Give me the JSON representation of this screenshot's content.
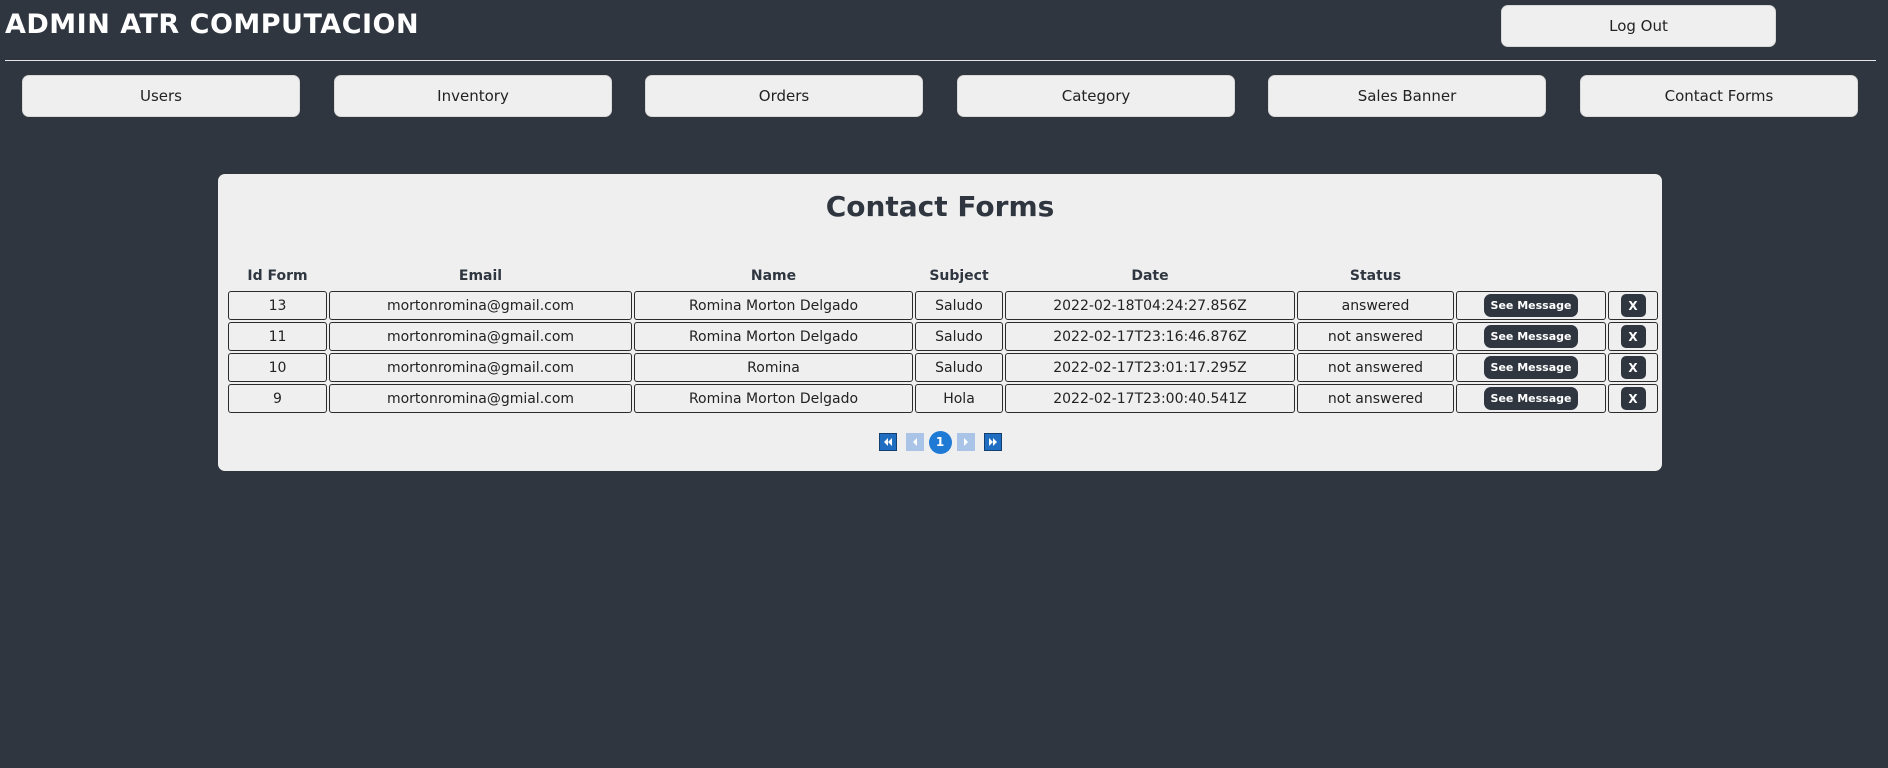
{
  "header": {
    "title": "ADMIN ATR COMPUTACION",
    "logout_label": "Log Out"
  },
  "nav": {
    "items": [
      {
        "label": "Users"
      },
      {
        "label": "Inventory"
      },
      {
        "label": "Orders"
      },
      {
        "label": "Category"
      },
      {
        "label": "Sales Banner"
      },
      {
        "label": "Contact Forms"
      }
    ]
  },
  "panel": {
    "title": "Contact Forms",
    "columns": [
      "Id Form",
      "Email",
      "Name",
      "Subject",
      "Date",
      "Status",
      "",
      ""
    ],
    "see_label": "See Message",
    "delete_label": "X",
    "rows": [
      {
        "id": "13",
        "email": "mortonromina@gmail.com",
        "name": "Romina Morton Delgado",
        "subject": "Saludo",
        "date": "2022-02-18T04:24:27.856Z",
        "status": "answered"
      },
      {
        "id": "11",
        "email": "mortonromina@gmail.com",
        "name": "Romina Morton Delgado",
        "subject": "Saludo",
        "date": "2022-02-17T23:16:46.876Z",
        "status": "not answered"
      },
      {
        "id": "10",
        "email": "mortonromina@gmail.com",
        "name": "Romina",
        "subject": "Saludo",
        "date": "2022-02-17T23:01:17.295Z",
        "status": "not answered"
      },
      {
        "id": "9",
        "email": "mortonromina@gmial.com",
        "name": "Romina Morton Delgado",
        "subject": "Hola",
        "date": "2022-02-17T23:00:40.541Z",
        "status": "not answered"
      }
    ]
  },
  "pagination": {
    "current_page": "1",
    "first_icon": "double-left-arrow-icon",
    "prev_icon": "left-arrow-icon",
    "next_icon": "right-arrow-icon",
    "last_icon": "double-right-arrow-icon"
  },
  "colors": {
    "background": "#2f3640",
    "panel": "#efefef",
    "button": "#efefef",
    "accent": "#1f7ad6"
  }
}
